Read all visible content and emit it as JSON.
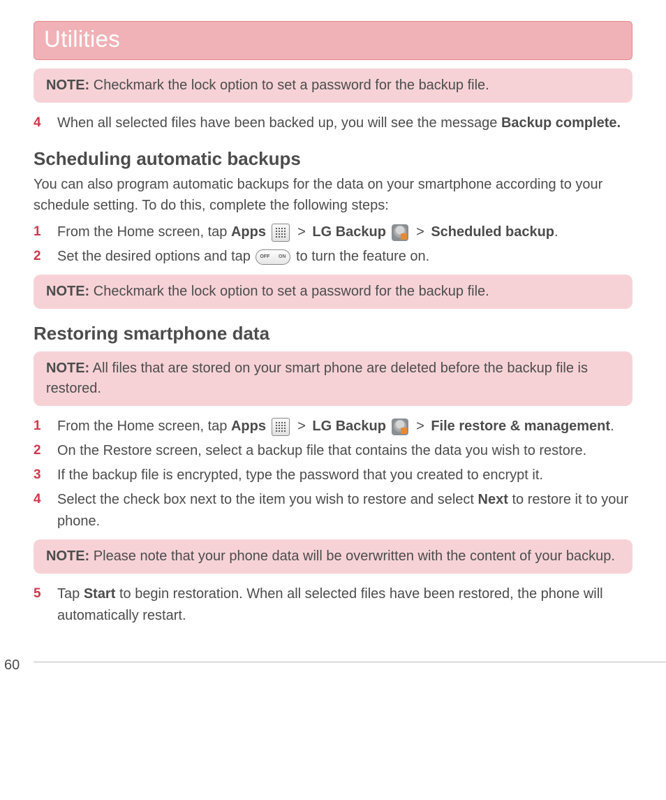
{
  "header": {
    "title": "Utilities"
  },
  "labels": {
    "note": "NOTE:"
  },
  "notes": {
    "n1": "Checkmark the lock option to set a password for the backup file.",
    "n2": "Checkmark the lock option to set a password for the backup file.",
    "n3": "All files that are stored on your smart phone are deleted before the backup file is restored.",
    "n4": "Please note that your phone data will be overwritten with the content of your backup."
  },
  "top_step": {
    "num": "4",
    "pre": "When all selected files have been backed up, you will see the message ",
    "boldEnd": "Backup complete."
  },
  "schedule": {
    "heading": "Scheduling automatic backups",
    "intro": "You can also program automatic backups for the data on your smartphone according to your schedule setting. To do this, complete the following steps:",
    "s1_num": "1",
    "s1_a": "From the Home screen, tap ",
    "s1_apps": "Apps",
    "s1_gt1": ">",
    "s1_lg": "LG Backup",
    "s1_gt2": ">",
    "s1_sched": "Scheduled backup",
    "s1_dot": ".",
    "s2_num": "2",
    "s2_a": "Set the desired options and tap ",
    "s2_b": " to turn the feature on."
  },
  "restore": {
    "heading": "Restoring smartphone data",
    "r1_num": "1",
    "r1_a": "From the Home screen, tap ",
    "r1_apps": "Apps",
    "r1_gt1": ">",
    "r1_lg": "LG Backup",
    "r1_gt2": ">",
    "r1_file": "File restore & management",
    "r1_dot": ".",
    "r2_num": "2",
    "r2": "On the Restore screen, select a backup file that contains the data you wish to restore.",
    "r3_num": "3",
    "r3": "If the backup file is encrypted, type the password that you created to encrypt it.",
    "r4_num": "4",
    "r4_a": "Select the check box next to the item you wish to restore and select ",
    "r4_next": "Next",
    "r4_b": " to restore it to your phone.",
    "r5_num": "5",
    "r5_a": "Tap ",
    "r5_start": "Start",
    "r5_b": " to begin restoration. When all selected files have been restored, the phone will automatically restart."
  },
  "pageNumber": "60"
}
